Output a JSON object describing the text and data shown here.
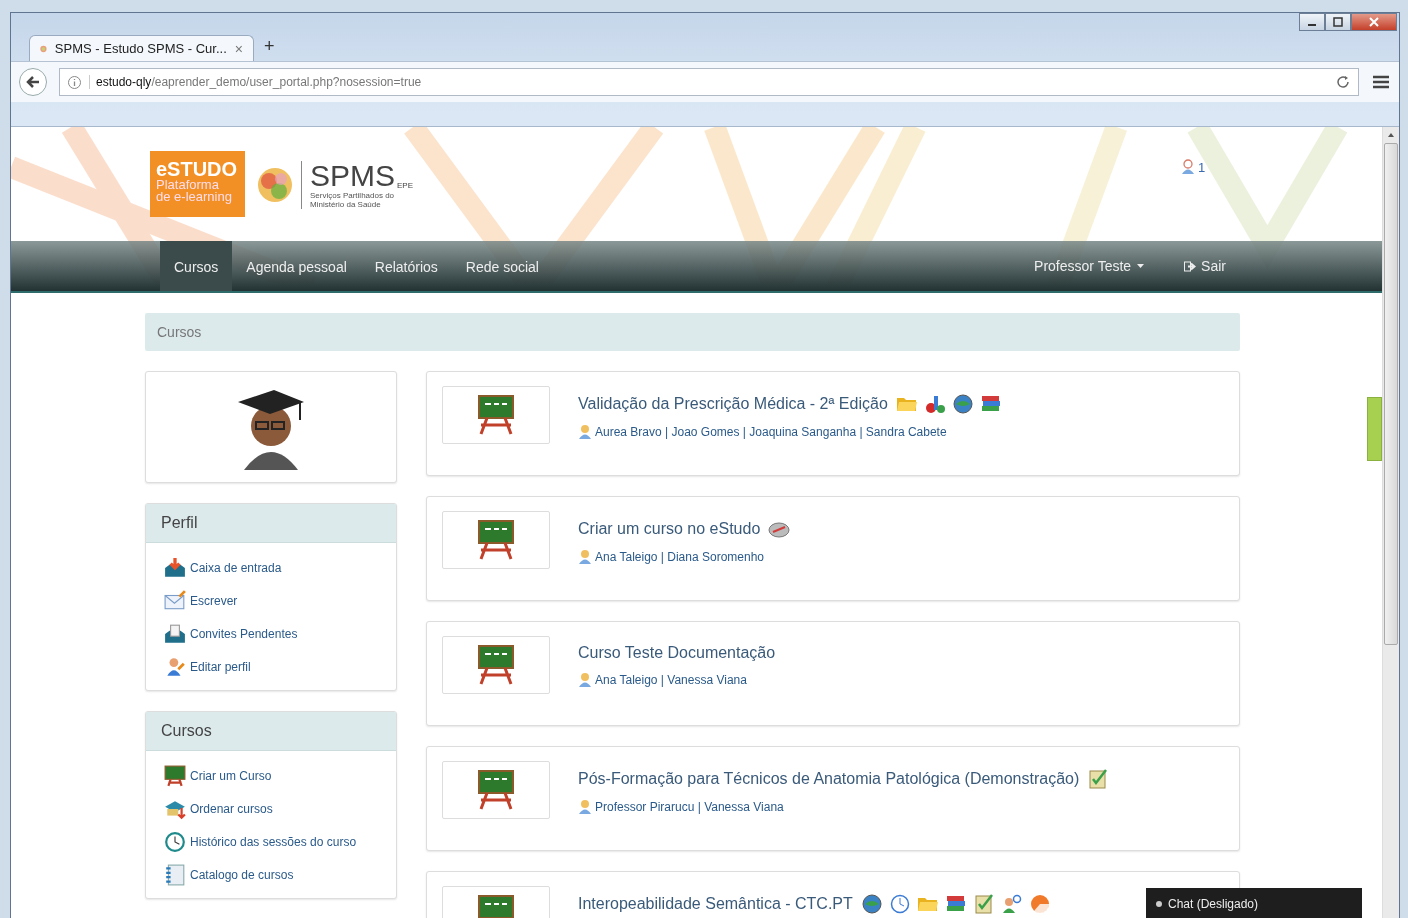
{
  "browser": {
    "tab_title": "SPMS - Estudo SPMS - Cur...",
    "tab_close": "×",
    "new_tab": "+",
    "url_host": "estudo-qly",
    "url_path": "/eaprender_demo/user_portal.php?nosession=true"
  },
  "header": {
    "logo_title": "eSTUDO",
    "logo_line1": "Plataforma",
    "logo_line2": "de e-learning",
    "org_name": "SPMS",
    "org_suffix": "EPE",
    "org_line1": "Serviços Partilhados do",
    "org_line2": "Ministério da Saúde",
    "notifications": "1"
  },
  "nav": {
    "items": [
      {
        "label": "Cursos",
        "selected": true
      },
      {
        "label": "Agenda pessoal",
        "selected": false
      },
      {
        "label": "Relatórios",
        "selected": false
      },
      {
        "label": "Rede social",
        "selected": false
      }
    ],
    "user": "Professor Teste",
    "logout": "Sair"
  },
  "breadcrumb": "Cursos",
  "panels": [
    {
      "title": "Perfil",
      "items": [
        {
          "label": "Caixa de entrada",
          "kind": "inbox"
        },
        {
          "label": "Escrever",
          "kind": "compose"
        },
        {
          "label": "Convites Pendentes",
          "kind": "invites"
        },
        {
          "label": "Editar perfil",
          "kind": "profile"
        }
      ]
    },
    {
      "title": "Cursos",
      "items": [
        {
          "label": "Criar um Curso",
          "kind": "create"
        },
        {
          "label": "Ordenar cursos",
          "kind": "sort"
        },
        {
          "label": "Histórico das sessões do curso",
          "kind": "history"
        },
        {
          "label": "Catalogo de cursos",
          "kind": "catalog"
        }
      ]
    }
  ],
  "courses": [
    {
      "title": "Validação da Prescrição Médica - 2ª Edição",
      "teachers": "Aurea Bravo | Joao Gomes | Joaquina Sanganha | Sandra Cabete",
      "tools": [
        {
          "kind": "folder"
        },
        {
          "kind": "abc"
        },
        {
          "kind": "globe"
        },
        {
          "kind": "books"
        }
      ]
    },
    {
      "title": "Criar um curso no eStudo",
      "teachers": "Ana Taleigo | Diana Soromenho",
      "tools": [
        {
          "kind": "compass"
        }
      ]
    },
    {
      "title": "Curso Teste Documentação",
      "teachers": "Ana Taleigo | Vanessa Viana"
    },
    {
      "title": "Pós-Formação para Técnicos de Anatomia Patológica (Demonstração)",
      "teachers": "Professor Pirarucu | Vanessa Viana",
      "tools": [
        {
          "kind": "checklist"
        }
      ]
    },
    {
      "title": "Interopeabilidade Semântica - CTC.PT",
      "tools": [
        {
          "kind": "globe"
        },
        {
          "kind": "clock"
        },
        {
          "kind": "folder"
        },
        {
          "kind": "books"
        },
        {
          "kind": "checklist"
        },
        {
          "kind": "users"
        },
        {
          "kind": "pie"
        }
      ]
    }
  ],
  "chat": "Chat (Desligado)"
}
